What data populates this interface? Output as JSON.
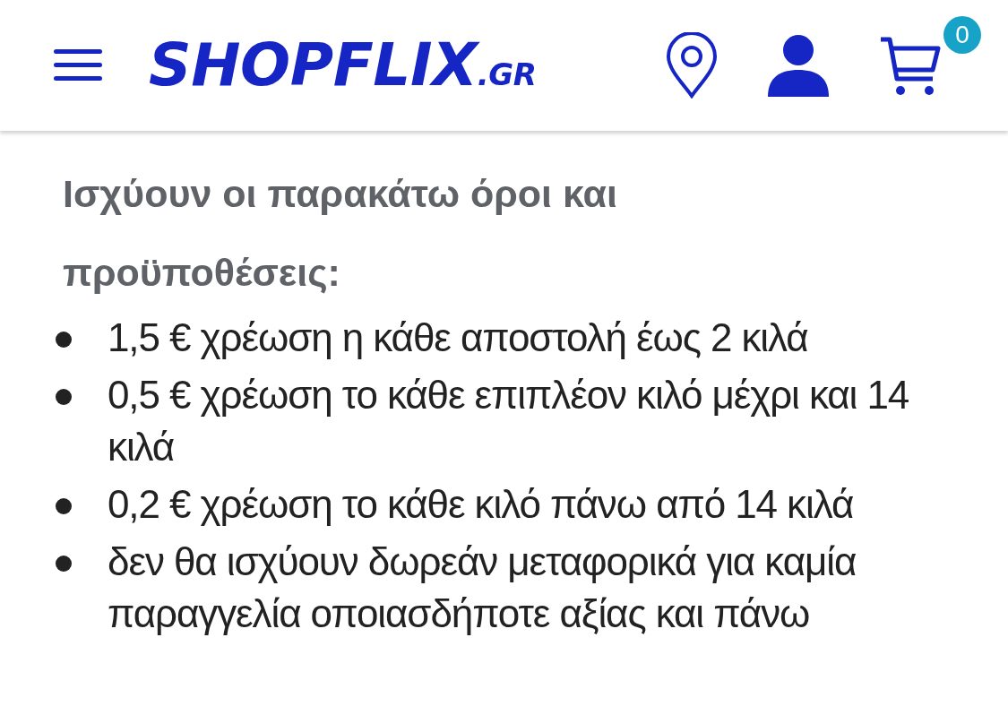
{
  "header": {
    "logo": {
      "name": "SHOPFLIX",
      "suffix": ".GR"
    },
    "cart_count": "0"
  },
  "heading": "Ισχύουν οι παρακάτω όροι και προϋποθέσεις:",
  "items": [
    "1,5 € χρέωση η κάθε αποστολή έως 2 κιλά",
    "0,5 € χρέωση το κάθε επιπλέον κιλό μέχρι και 14 κιλά",
    "0,2 € χρέωση το κάθε κιλό πάνω από 14 κιλά",
    "δεν θα ισχύουν δωρεάν μεταφορικά για καμία παραγγελία οποιασδήποτε αξίας και πάνω"
  ]
}
